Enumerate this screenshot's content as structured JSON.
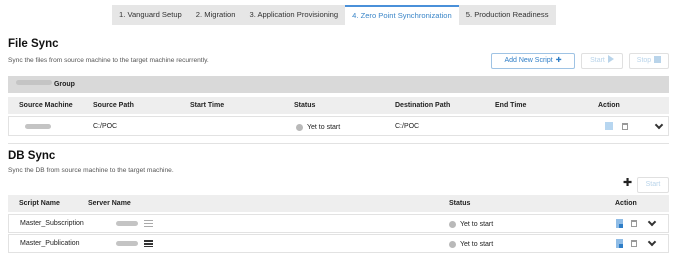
{
  "tabs": [
    {
      "label": "1. Vanguard Setup",
      "active": false
    },
    {
      "label": "2. Migration",
      "active": false
    },
    {
      "label": "3. Application Provisioning",
      "active": false
    },
    {
      "label": "4. Zero Point Synchronization",
      "active": true
    },
    {
      "label": "5. Production Readiness",
      "active": false
    }
  ],
  "file_sync": {
    "title": "File Sync",
    "description": "Sync the files from source machine to the target machine recurrently.",
    "add_button": "Add New Script",
    "start_button": "Start",
    "stop_button": "Stop",
    "group_label": "Group",
    "columns": [
      "Source Machine",
      "Source Path",
      "Start Time",
      "Status",
      "Destination Path",
      "End Time",
      "Action"
    ],
    "rows": [
      {
        "source_path": "C:/POC",
        "start_time": "",
        "status": "Yet to start",
        "destination_path": "C:/POC",
        "end_time": ""
      }
    ]
  },
  "db_sync": {
    "title": "DB Sync",
    "description": "Sync the DB from source machine to the target machine.",
    "start_button": "Start",
    "columns": [
      "Script Name",
      "Server Name",
      "Status",
      "Action"
    ],
    "rows": [
      {
        "script_name": "Master_Subscription",
        "status": "Yet to start"
      },
      {
        "script_name": "Master_Publication",
        "status": "Yet to start"
      }
    ]
  },
  "colors": {
    "accent": "#2f7ec7",
    "header_bg": "#d9d9d9",
    "disabled": "#b9d4ea"
  }
}
